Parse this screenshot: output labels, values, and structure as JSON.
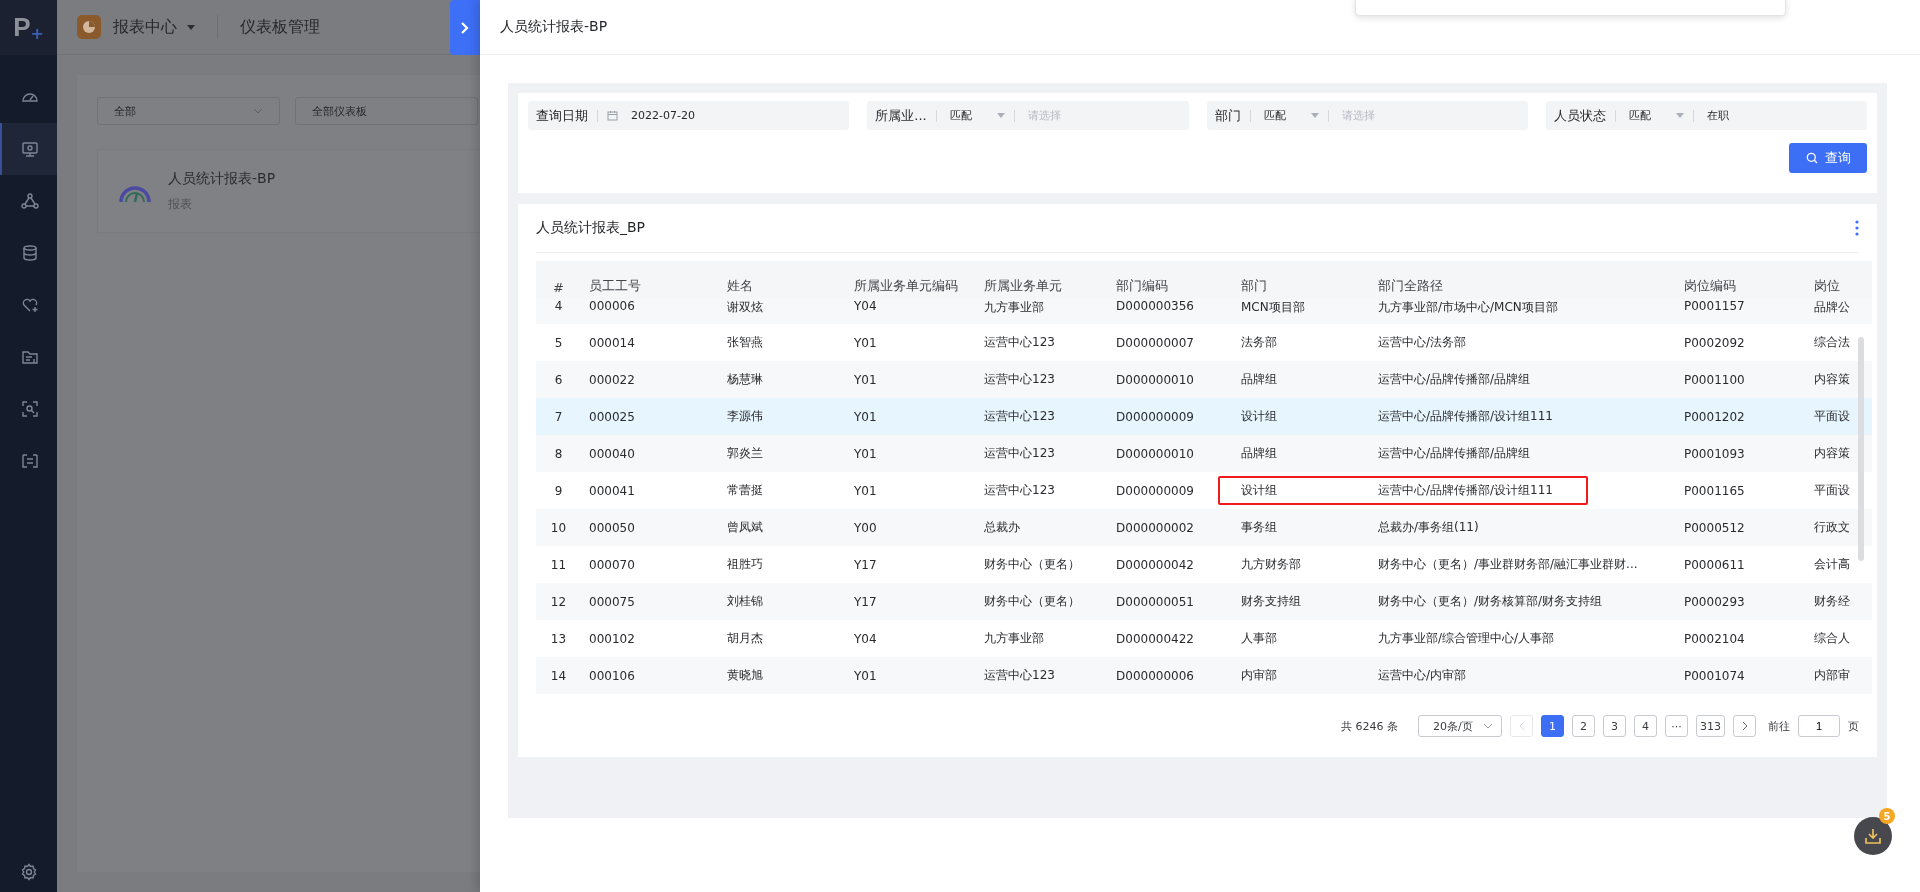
{
  "app": {
    "logo": "P",
    "logo_plus": "+",
    "module": "报表中心",
    "page": "仪表板管理"
  },
  "sidebar": {
    "items": [
      {
        "selected": false
      },
      {
        "selected": true
      },
      {
        "selected": false
      },
      {
        "selected": false
      },
      {
        "selected": false
      },
      {
        "selected": false
      },
      {
        "selected": false
      },
      {
        "selected": false
      }
    ]
  },
  "background_filters": [
    {
      "value": "全部"
    },
    {
      "value": "全部仪表板"
    }
  ],
  "background_card": {
    "title": "人员统计报表-BP",
    "subtitle": "报表"
  },
  "drawer": {
    "title": "人员统计报表-BP",
    "filters": [
      {
        "kind": "date",
        "label": "查询日期",
        "value": "2022-07-20"
      },
      {
        "kind": "match",
        "label": "所属业...",
        "operator": "匹配",
        "placeholder": "请选择"
      },
      {
        "kind": "match",
        "label": "部门",
        "operator": "匹配",
        "placeholder": "请选择"
      },
      {
        "kind": "match",
        "label": "人员状态",
        "operator": "匹配",
        "value": "在职"
      }
    ],
    "query_button": "查询",
    "table_title": "人员统计报表_BP",
    "columns": [
      "#",
      "员工工号",
      "姓名",
      "所属业务单元编码",
      "所属业务单元",
      "部门编码",
      "部门",
      "部门全路径",
      "岗位编码",
      "岗位"
    ],
    "rows": [
      {
        "selected": false,
        "marked": false,
        "partial": true,
        "cells": [
          "4",
          "000006",
          "谢双炫",
          "Y04",
          "九方事业部",
          "D000000356",
          "MCN项目部",
          "九方事业部/市场中心/MCN项目部",
          "P0001157",
          "品牌公"
        ]
      },
      {
        "selected": false,
        "marked": false,
        "cells": [
          "5",
          "000014",
          "张智燕",
          "Y01",
          "运营中心123",
          "D000000007",
          "法务部",
          "运营中心/法务部",
          "P0002092",
          "综合法"
        ]
      },
      {
        "selected": false,
        "marked": false,
        "cells": [
          "6",
          "000022",
          "杨慧琳",
          "Y01",
          "运营中心123",
          "D000000010",
          "品牌组",
          "运营中心/品牌传播部/品牌组",
          "P0001100",
          "内容策"
        ]
      },
      {
        "selected": true,
        "marked": false,
        "cells": [
          "7",
          "000025",
          "李源伟",
          "Y01",
          "运营中心123",
          "D000000009",
          "设计组",
          "运营中心/品牌传播部/设计组111",
          "P0001202",
          "平面设"
        ]
      },
      {
        "selected": false,
        "marked": false,
        "cells": [
          "8",
          "000040",
          "郭炎兰",
          "Y01",
          "运营中心123",
          "D000000010",
          "品牌组",
          "运营中心/品牌传播部/品牌组",
          "P0001093",
          "内容策"
        ]
      },
      {
        "selected": false,
        "marked": true,
        "cells": [
          "9",
          "000041",
          "常蕾挺",
          "Y01",
          "运营中心123",
          "D000000009",
          "设计组",
          "运营中心/品牌传播部/设计组111",
          "P0001165",
          "平面设"
        ]
      },
      {
        "selected": false,
        "marked": false,
        "cells": [
          "10",
          "000050",
          "曾凤斌",
          "Y00",
          "总裁办",
          "D000000002",
          "事务组",
          "总裁办/事务组(11)",
          "P0000512",
          "行政文"
        ]
      },
      {
        "selected": false,
        "marked": false,
        "cells": [
          "11",
          "000070",
          "祖胜巧",
          "Y17",
          "财务中心（更名）",
          "D000000042",
          "九方财务部",
          "财务中心（更名）/事业群财务部/融汇事业群财...",
          "P0000611",
          "会计高"
        ]
      },
      {
        "selected": false,
        "marked": false,
        "cells": [
          "12",
          "000075",
          "刘桂锦",
          "Y17",
          "财务中心（更名）",
          "D000000051",
          "财务支持组",
          "财务中心（更名）/财务核算部/财务支持组",
          "P0000293",
          "财务经"
        ]
      },
      {
        "selected": false,
        "marked": false,
        "cells": [
          "13",
          "000102",
          "胡月杰",
          "Y04",
          "九方事业部",
          "D000000422",
          "人事部",
          "九方事业部/综合管理中心/人事部",
          "P0002104",
          "综合人"
        ]
      },
      {
        "selected": false,
        "marked": false,
        "cells": [
          "14",
          "000106",
          "黄晓旭",
          "Y01",
          "运营中心123",
          "D000000006",
          "内审部",
          "运营中心/内审部",
          "P0001074",
          "内部审"
        ]
      }
    ],
    "pagination": {
      "total": "共 6246 条",
      "page_size": "20条/页",
      "pages": [
        {
          "label": "1",
          "selected": true
        },
        {
          "label": "2",
          "selected": false
        },
        {
          "label": "3",
          "selected": false
        },
        {
          "label": "4",
          "selected": false
        },
        {
          "label": "···",
          "selected": false
        },
        {
          "label": "313",
          "selected": false
        }
      ],
      "prev_disabled": true,
      "goto_label": "前往",
      "goto_value": "1",
      "goto_suffix": "页"
    }
  },
  "download_badge": "5"
}
